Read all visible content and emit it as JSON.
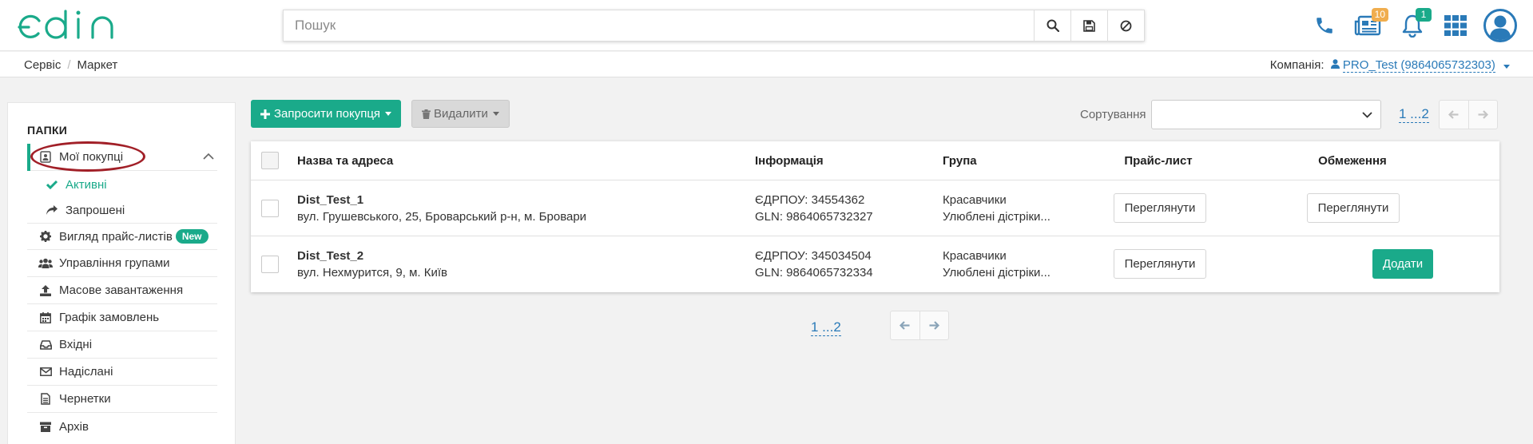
{
  "brand": {
    "logo_text": "edin",
    "accent": "#1aaa8a"
  },
  "search": {
    "placeholder": "Пошук",
    "icons": [
      "search-icon",
      "save-icon",
      "clear-icon"
    ]
  },
  "header": {
    "icons": [
      "phone-icon",
      "news-icon",
      "bell-icon",
      "apps-grid-icon",
      "user-avatar-icon"
    ],
    "news_badge": "10",
    "bell_badge": "1"
  },
  "breadcrumb": {
    "items": [
      "Сервіс",
      "Маркет"
    ]
  },
  "company": {
    "label": "Компанія:",
    "name": "PRO_Test (9864065732303)"
  },
  "sidebar": {
    "title": "ПАПКИ",
    "items": [
      {
        "label": "Мої покупці",
        "icon": "contact-book-icon"
      },
      {
        "label": "Активні",
        "icon": "check-icon"
      },
      {
        "label": "Запрошені",
        "icon": "share-icon"
      },
      {
        "label": "Вигляд прайс-листів",
        "icon": "cog-icon",
        "badge": "New"
      },
      {
        "label": "Управління групами",
        "icon": "users-icon"
      },
      {
        "label": "Масове завантаження",
        "icon": "upload-icon"
      },
      {
        "label": "Графік замовлень",
        "icon": "calendar-icon"
      },
      {
        "label": "Вхідні",
        "icon": "inbox-icon"
      },
      {
        "label": "Надіслані",
        "icon": "envelope-icon"
      },
      {
        "label": "Чернетки",
        "icon": "draft-icon"
      },
      {
        "label": "Архів",
        "icon": "archive-icon"
      }
    ]
  },
  "toolbar": {
    "invite_label": "Запросити покупця",
    "delete_label": "Видалити",
    "sort_label": "Сортування",
    "sort_value": "",
    "pager": "1 ...2"
  },
  "table": {
    "columns": [
      "Назва та адреса",
      "Інформація",
      "Група",
      "Прайс-лист",
      "Обмеження"
    ],
    "rows": [
      {
        "name": "Dist_Test_1",
        "address": "вул. Грушевського, 25, Броварський р-н, м. Бровари",
        "edrpou": "ЄДРПОУ: 34554362",
        "gln": "GLN: 9864065732327",
        "group1": "Красавчики",
        "group2": "Улюблені дістріки...",
        "price": "Переглянути",
        "limit": "Переглянути"
      },
      {
        "name": "Dist_Test_2",
        "address": "вул. Нехмурится, 9, м. Київ",
        "edrpou": "ЄДРПОУ: 345034504",
        "gln": "GLN: 9864065732334",
        "group1": "Красавчики",
        "group2": "Улюблені дістріки...",
        "price": "Переглянути",
        "limit": "Додати"
      }
    ]
  },
  "bottom_pager": "1 ...2"
}
